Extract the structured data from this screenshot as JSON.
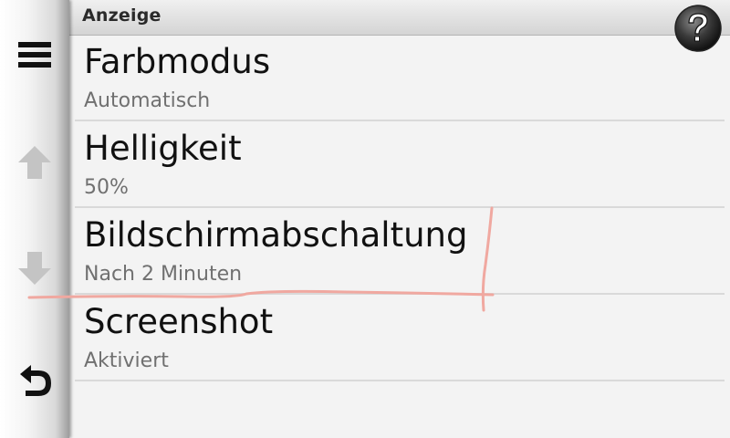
{
  "header": {
    "title": "Anzeige",
    "help_icon": "question-mark-icon"
  },
  "rail": {
    "menu_icon": "hamburger-menu-icon",
    "up_icon": "arrow-up-icon",
    "down_icon": "arrow-down-icon",
    "back_icon": "back-arrow-icon"
  },
  "settings": [
    {
      "title": "Farbmodus",
      "value": "Automatisch"
    },
    {
      "title": "Helligkeit",
      "value": "50%"
    },
    {
      "title": "Bildschirmabschaltung",
      "value": "Nach 2 Minuten"
    },
    {
      "title": "Screenshot",
      "value": "Aktiviert"
    }
  ],
  "colors": {
    "text_primary": "#111111",
    "text_secondary": "#707070",
    "annotation": "#f0a8a0"
  }
}
